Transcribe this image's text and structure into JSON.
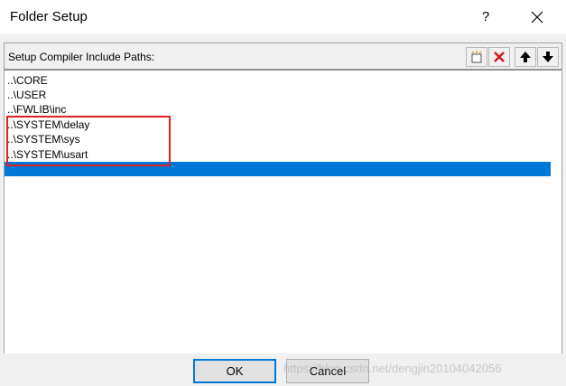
{
  "window": {
    "title": "Folder Setup",
    "help_label": "?"
  },
  "panel": {
    "label": "Setup Compiler Include Paths:",
    "toolbar": [
      "new-folder-icon",
      "delete-icon",
      "move-up-icon",
      "move-down-icon"
    ]
  },
  "paths": [
    "..\\CORE",
    "..\\USER",
    "..\\FWLIB\\inc",
    "..\\SYSTEM\\delay",
    "..\\SYSTEM\\sys",
    "..\\SYSTEM\\usart"
  ],
  "buttons": {
    "ok": "OK",
    "cancel": "Cancel"
  },
  "watermark": "https://blog.csdn.net/dengjin20104042056",
  "colors": {
    "selection": "#0078d7",
    "annotation_box": "#e0201f",
    "delete_icon": "#d01818"
  }
}
